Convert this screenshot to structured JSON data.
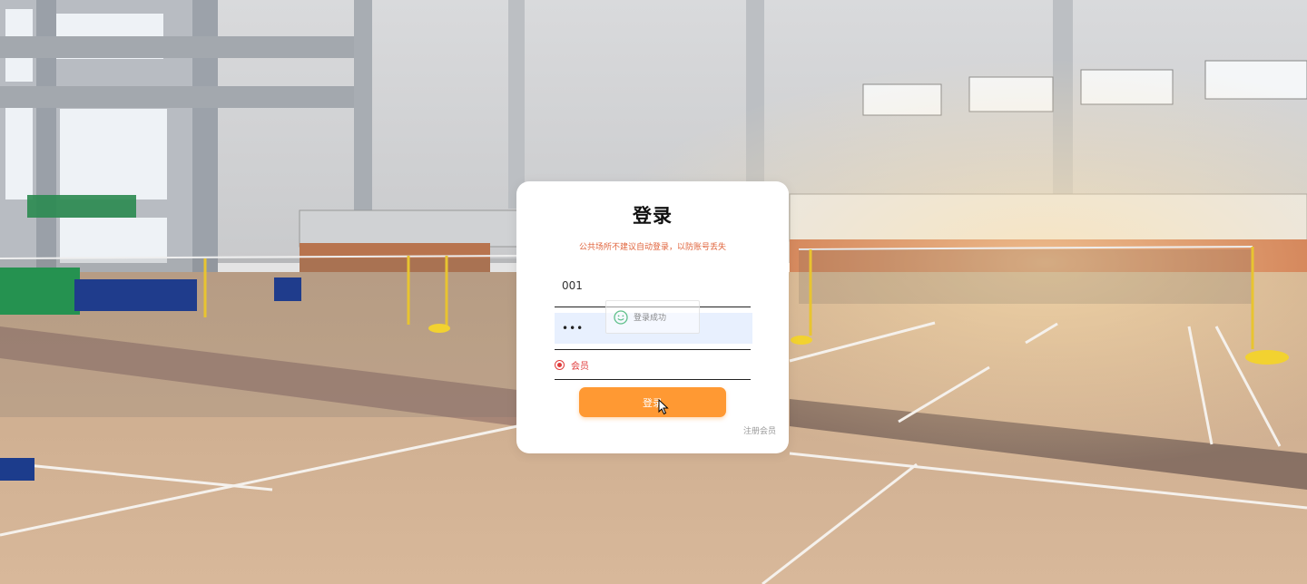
{
  "login": {
    "title": "登录",
    "tip": "公共场所不建议自动登录，以防账号丢失",
    "account_value": "001",
    "password_value": "•••",
    "role_option": "会员",
    "submit_label": "登录",
    "register_link": "注册会员"
  },
  "toast": {
    "message": "登录成功",
    "icon": "smile-icon"
  },
  "colors": {
    "accent": "#ff9933",
    "tip": "#e0643c",
    "radio": "#e03c3c",
    "card": "#ffffff"
  }
}
